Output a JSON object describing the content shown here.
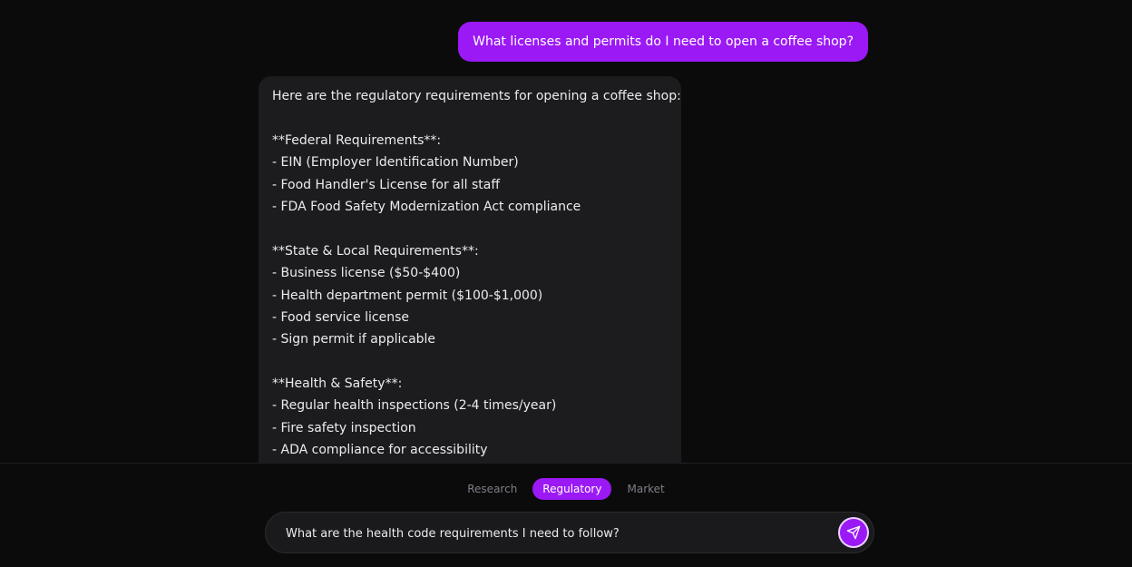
{
  "chat": {
    "user_message": "What licenses and permits do I need to open a coffee shop?",
    "assistant_lines": [
      "Here are the regulatory requirements for opening a coffee shop:",
      "",
      "**Federal Requirements**:",
      "- EIN (Employer Identification Number)",
      "- Food Handler's License for all staff",
      "- FDA Food Safety Modernization Act compliance",
      "",
      "**State & Local Requirements**:",
      "- Business license ($50-$400)",
      "- Health department permit ($100-$1,000)",
      "- Food service license",
      "- Sign permit if applicable",
      "",
      "**Health & Safety**:",
      "- Regular health inspections (2-4 times/year)",
      "- Fire safety inspection",
      "- ADA compliance for accessibility"
    ]
  },
  "tabs": [
    {
      "label": "Research",
      "active": false
    },
    {
      "label": "Regulatory",
      "active": true
    },
    {
      "label": "Market",
      "active": false
    }
  ],
  "composer": {
    "value": "What are the health code requirements I need to follow?",
    "send_icon": "send-icon"
  },
  "colors": {
    "accent": "#9b19f5",
    "background": "#0b0b0c",
    "bubble": "#1c1c1f"
  }
}
